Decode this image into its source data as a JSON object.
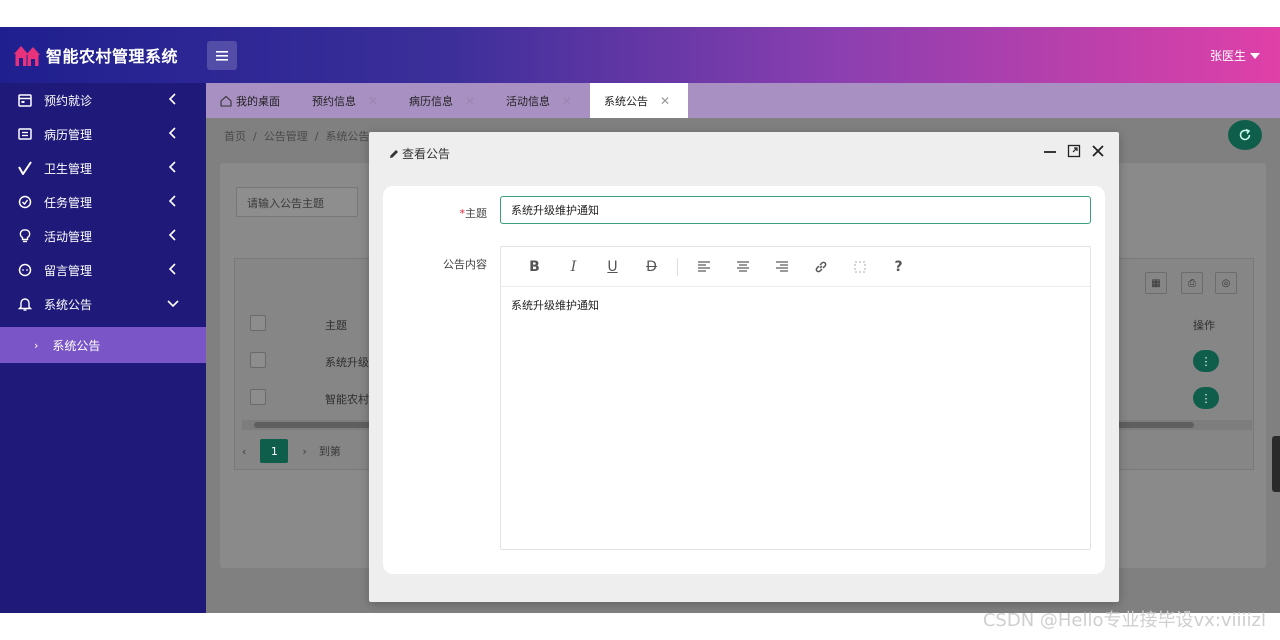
{
  "header": {
    "app_title": "智能农村管理系统",
    "user_name": "张医生"
  },
  "sidebar": {
    "items": [
      {
        "label": "预约就诊",
        "icon": "calendar-icon"
      },
      {
        "label": "病历管理",
        "icon": "record-icon"
      },
      {
        "label": "卫生管理",
        "icon": "check-icon"
      },
      {
        "label": "任务管理",
        "icon": "task-icon"
      },
      {
        "label": "活动管理",
        "icon": "bulb-icon"
      },
      {
        "label": "留言管理",
        "icon": "message-icon"
      },
      {
        "label": "系统公告",
        "icon": "bell-icon"
      }
    ],
    "sub_item": "系统公告"
  },
  "tabs": [
    {
      "label": "我的桌面"
    },
    {
      "label": "预约信息"
    },
    {
      "label": "病历信息"
    },
    {
      "label": "活动信息"
    },
    {
      "label": "系统公告"
    }
  ],
  "breadcrumb": {
    "home": "首页",
    "sep": "/",
    "level1": "公告管理",
    "level2": "系统公告"
  },
  "list": {
    "search_placeholder": "请输入公告主题",
    "col_subject": "主题",
    "col_action": "操作",
    "rows": [
      {
        "subject": "系统升级"
      },
      {
        "subject": "智能农村"
      }
    ],
    "page": "1",
    "goto_label": "到第"
  },
  "dialog": {
    "title": "查看公告",
    "subject_label": "主题",
    "subject_value": "系统升级维护通知",
    "content_label": "公告内容",
    "content_text": "系统升级维护通知",
    "toolbar": {
      "bold": "B",
      "italic": "I",
      "underline": "U",
      "strike": "D",
      "help": "?"
    }
  },
  "watermark": "CSDN @Hello专业接毕设vx:viiiizl",
  "colors": {
    "accent": "#0f5d4b",
    "sidebar": "#1f1a7a",
    "sidebar_active": "#7a55c8",
    "tabbar": "#a990c2",
    "focus_border": "#3aa07c"
  }
}
